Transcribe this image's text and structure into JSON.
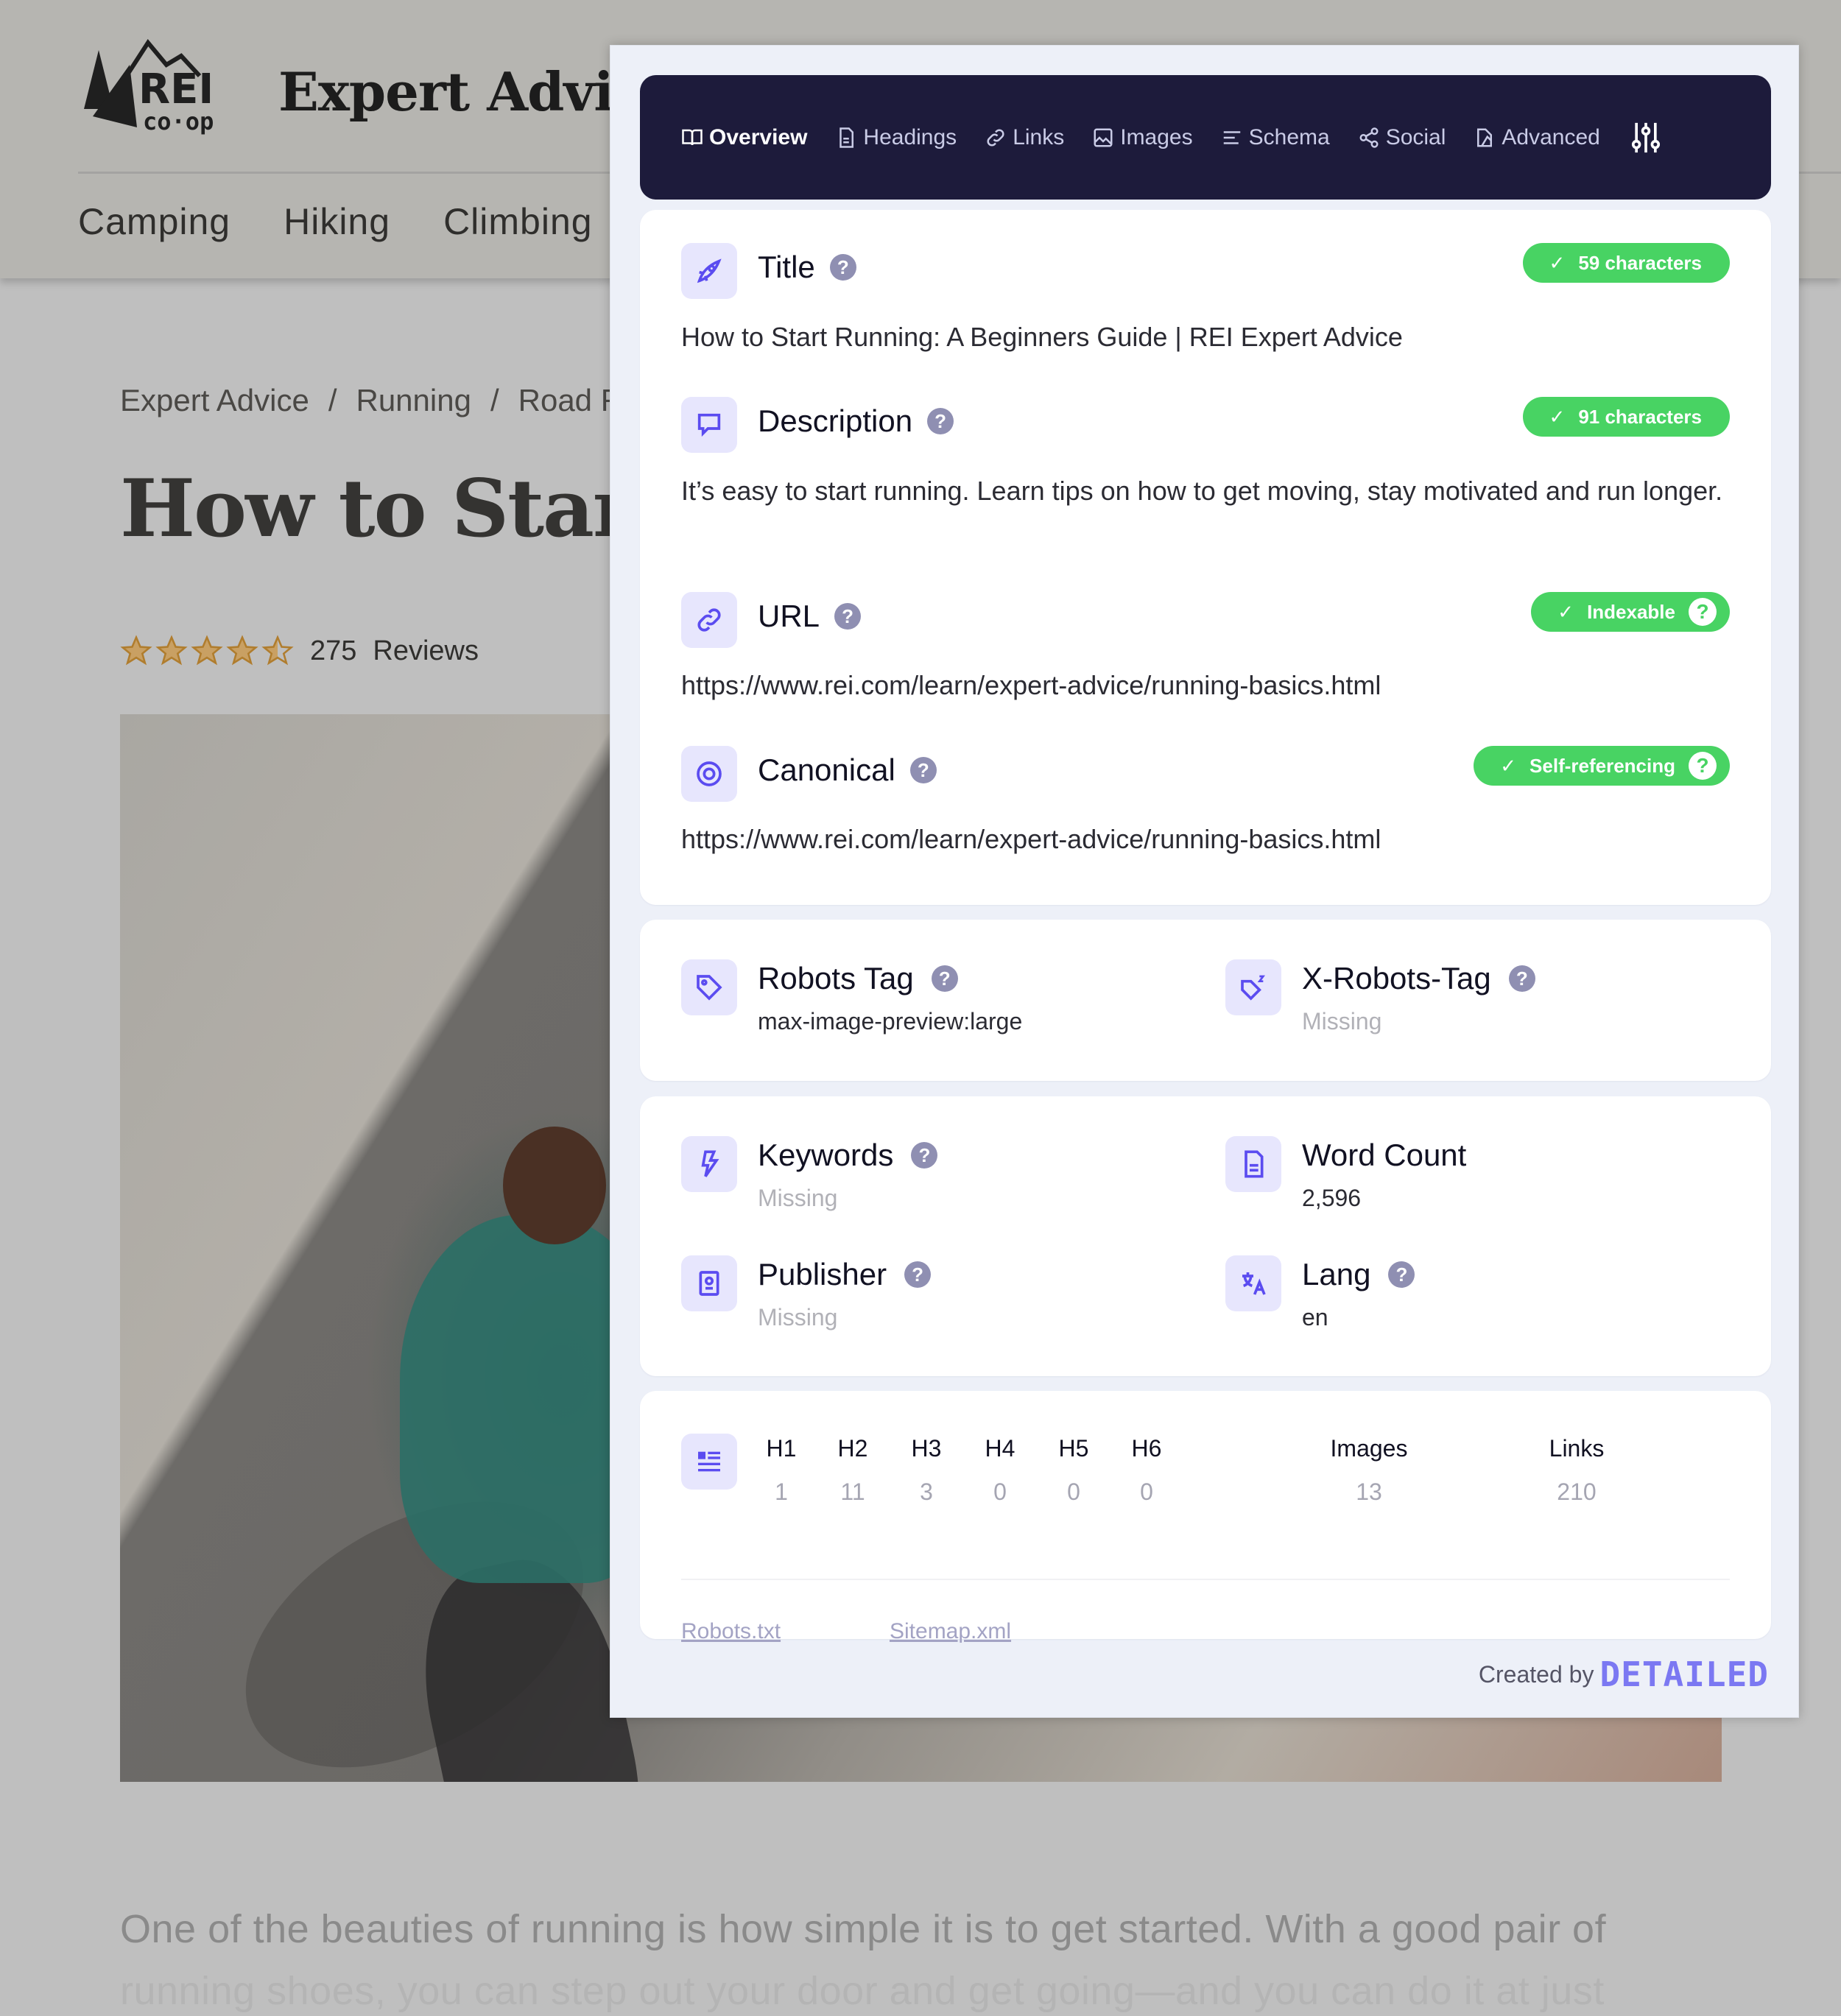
{
  "site": {
    "brand": "REI co-op",
    "section_title": "Expert Advice",
    "nav": [
      "Camping",
      "Hiking",
      "Climbing"
    ],
    "breadcrumb": [
      "Expert Advice",
      "Running",
      "Road R"
    ],
    "breadcrumb_separator": "/",
    "article_title": "How to Start R",
    "rating": {
      "value": 4.5,
      "max": 5,
      "count": "275",
      "reviews_label": "Reviews"
    },
    "intro_line1": "One of the beauties of running is how simple it is to get started. With a good pair of",
    "intro_line2": "running shoes, you can step out your door and get going—and you can do it at just",
    "star_color": "#b07d2e"
  },
  "panel": {
    "tabs": [
      {
        "label": "Overview",
        "icon": "book-open-icon",
        "active": true
      },
      {
        "label": "Headings",
        "icon": "document-icon",
        "active": false
      },
      {
        "label": "Links",
        "icon": "link-icon",
        "active": false
      },
      {
        "label": "Images",
        "icon": "image-icon",
        "active": false
      },
      {
        "label": "Schema",
        "icon": "align-left-icon",
        "active": false
      },
      {
        "label": "Social",
        "icon": "share-icon",
        "active": false
      },
      {
        "label": "Advanced",
        "icon": "advanced-icon",
        "active": false
      }
    ],
    "settings_icon": "sliders-icon",
    "meta": {
      "title": {
        "label": "Title",
        "value": "How to Start Running: A Beginners Guide | REI Expert Advice",
        "badge": "59 characters",
        "icon": "rocket-icon"
      },
      "description": {
        "label": "Description",
        "value": "It’s easy to start running. Learn tips on how to get moving, stay motivated and run longer.",
        "badge": "91 characters",
        "icon": "comment-icon"
      },
      "url": {
        "label": "URL",
        "value": "https://www.rei.com/learn/expert-advice/running-basics.html",
        "badge": "Indexable",
        "icon": "link-icon"
      },
      "canonical": {
        "label": "Canonical",
        "value": "https://www.rei.com/learn/expert-advice/running-basics.html",
        "badge": "Self-referencing",
        "icon": "target-icon"
      }
    },
    "robots": {
      "robots_tag": {
        "label": "Robots Tag",
        "value": "max-image-preview:large"
      },
      "x_robots_tag": {
        "label": "X-Robots-Tag",
        "value": "Missing"
      }
    },
    "info": {
      "keywords": {
        "label": "Keywords",
        "value": "Missing"
      },
      "word_count": {
        "label": "Word Count",
        "value": "2,596"
      },
      "publisher": {
        "label": "Publisher",
        "value": "Missing"
      },
      "lang": {
        "label": "Lang",
        "value": "en"
      }
    },
    "stats": {
      "headings": [
        {
          "label": "H1",
          "value": "1"
        },
        {
          "label": "H2",
          "value": "11"
        },
        {
          "label": "H3",
          "value": "3"
        },
        {
          "label": "H4",
          "value": "0"
        },
        {
          "label": "H5",
          "value": "0"
        },
        {
          "label": "H6",
          "value": "0"
        }
      ],
      "images": {
        "label": "Images",
        "value": "13"
      },
      "links": {
        "label": "Links",
        "value": "210"
      },
      "files": [
        "Robots.txt",
        "Sitemap.xml"
      ]
    },
    "help_glyph": "?",
    "check_glyph": "✓",
    "credit": {
      "prefix": "Created by",
      "brand": "DETAILED"
    },
    "colors": {
      "nav_bg": "#1d1b3b",
      "accent": "#5b4cf0",
      "badge_green": "#48d363",
      "brand": "#7b78f2",
      "panel_bg": "#edf0f8"
    }
  }
}
